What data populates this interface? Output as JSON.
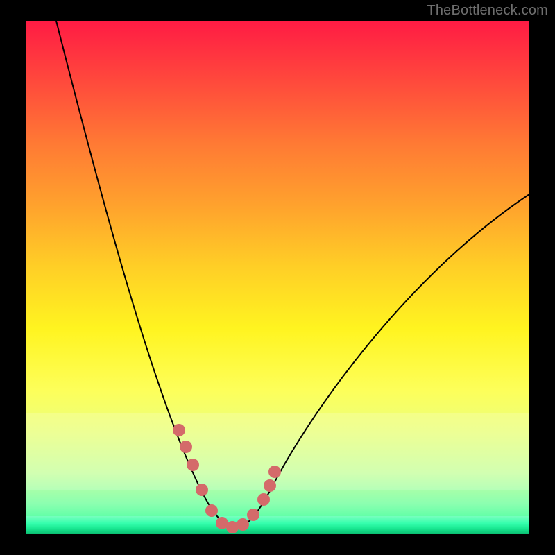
{
  "watermark": "TheBottleneck.com",
  "colors": {
    "background": "#000000",
    "curve_stroke": "#000000",
    "marker_fill": "#d46a6a",
    "gradient_top": "#ff1b44",
    "gradient_bottom": "#2bff9c"
  },
  "chart_data": {
    "type": "line",
    "title": "",
    "xlabel": "",
    "ylabel": "",
    "xlim": [
      0,
      100
    ],
    "ylim": [
      0,
      100
    ],
    "series": [
      {
        "name": "bottleneck-curve",
        "x": [
          6,
          10,
          14,
          18,
          22,
          26,
          29,
          32,
          34,
          36,
          38,
          40,
          42,
          45,
          48,
          52,
          58,
          66,
          76,
          88,
          100
        ],
        "y": [
          100,
          87,
          74,
          61,
          49,
          37,
          28,
          19,
          12,
          7,
          3,
          1,
          1,
          3,
          7,
          13,
          21,
          32,
          44,
          56,
          68
        ]
      }
    ],
    "markers": {
      "name": "highlight-range",
      "x": [
        31,
        32.2,
        33.3,
        35,
        37,
        39,
        41,
        43,
        45,
        47,
        48.3,
        49.3
      ],
      "y": [
        22,
        18.5,
        14.5,
        9,
        4,
        1.2,
        0.7,
        1.2,
        3.5,
        7.5,
        10.5,
        13.5
      ]
    }
  }
}
